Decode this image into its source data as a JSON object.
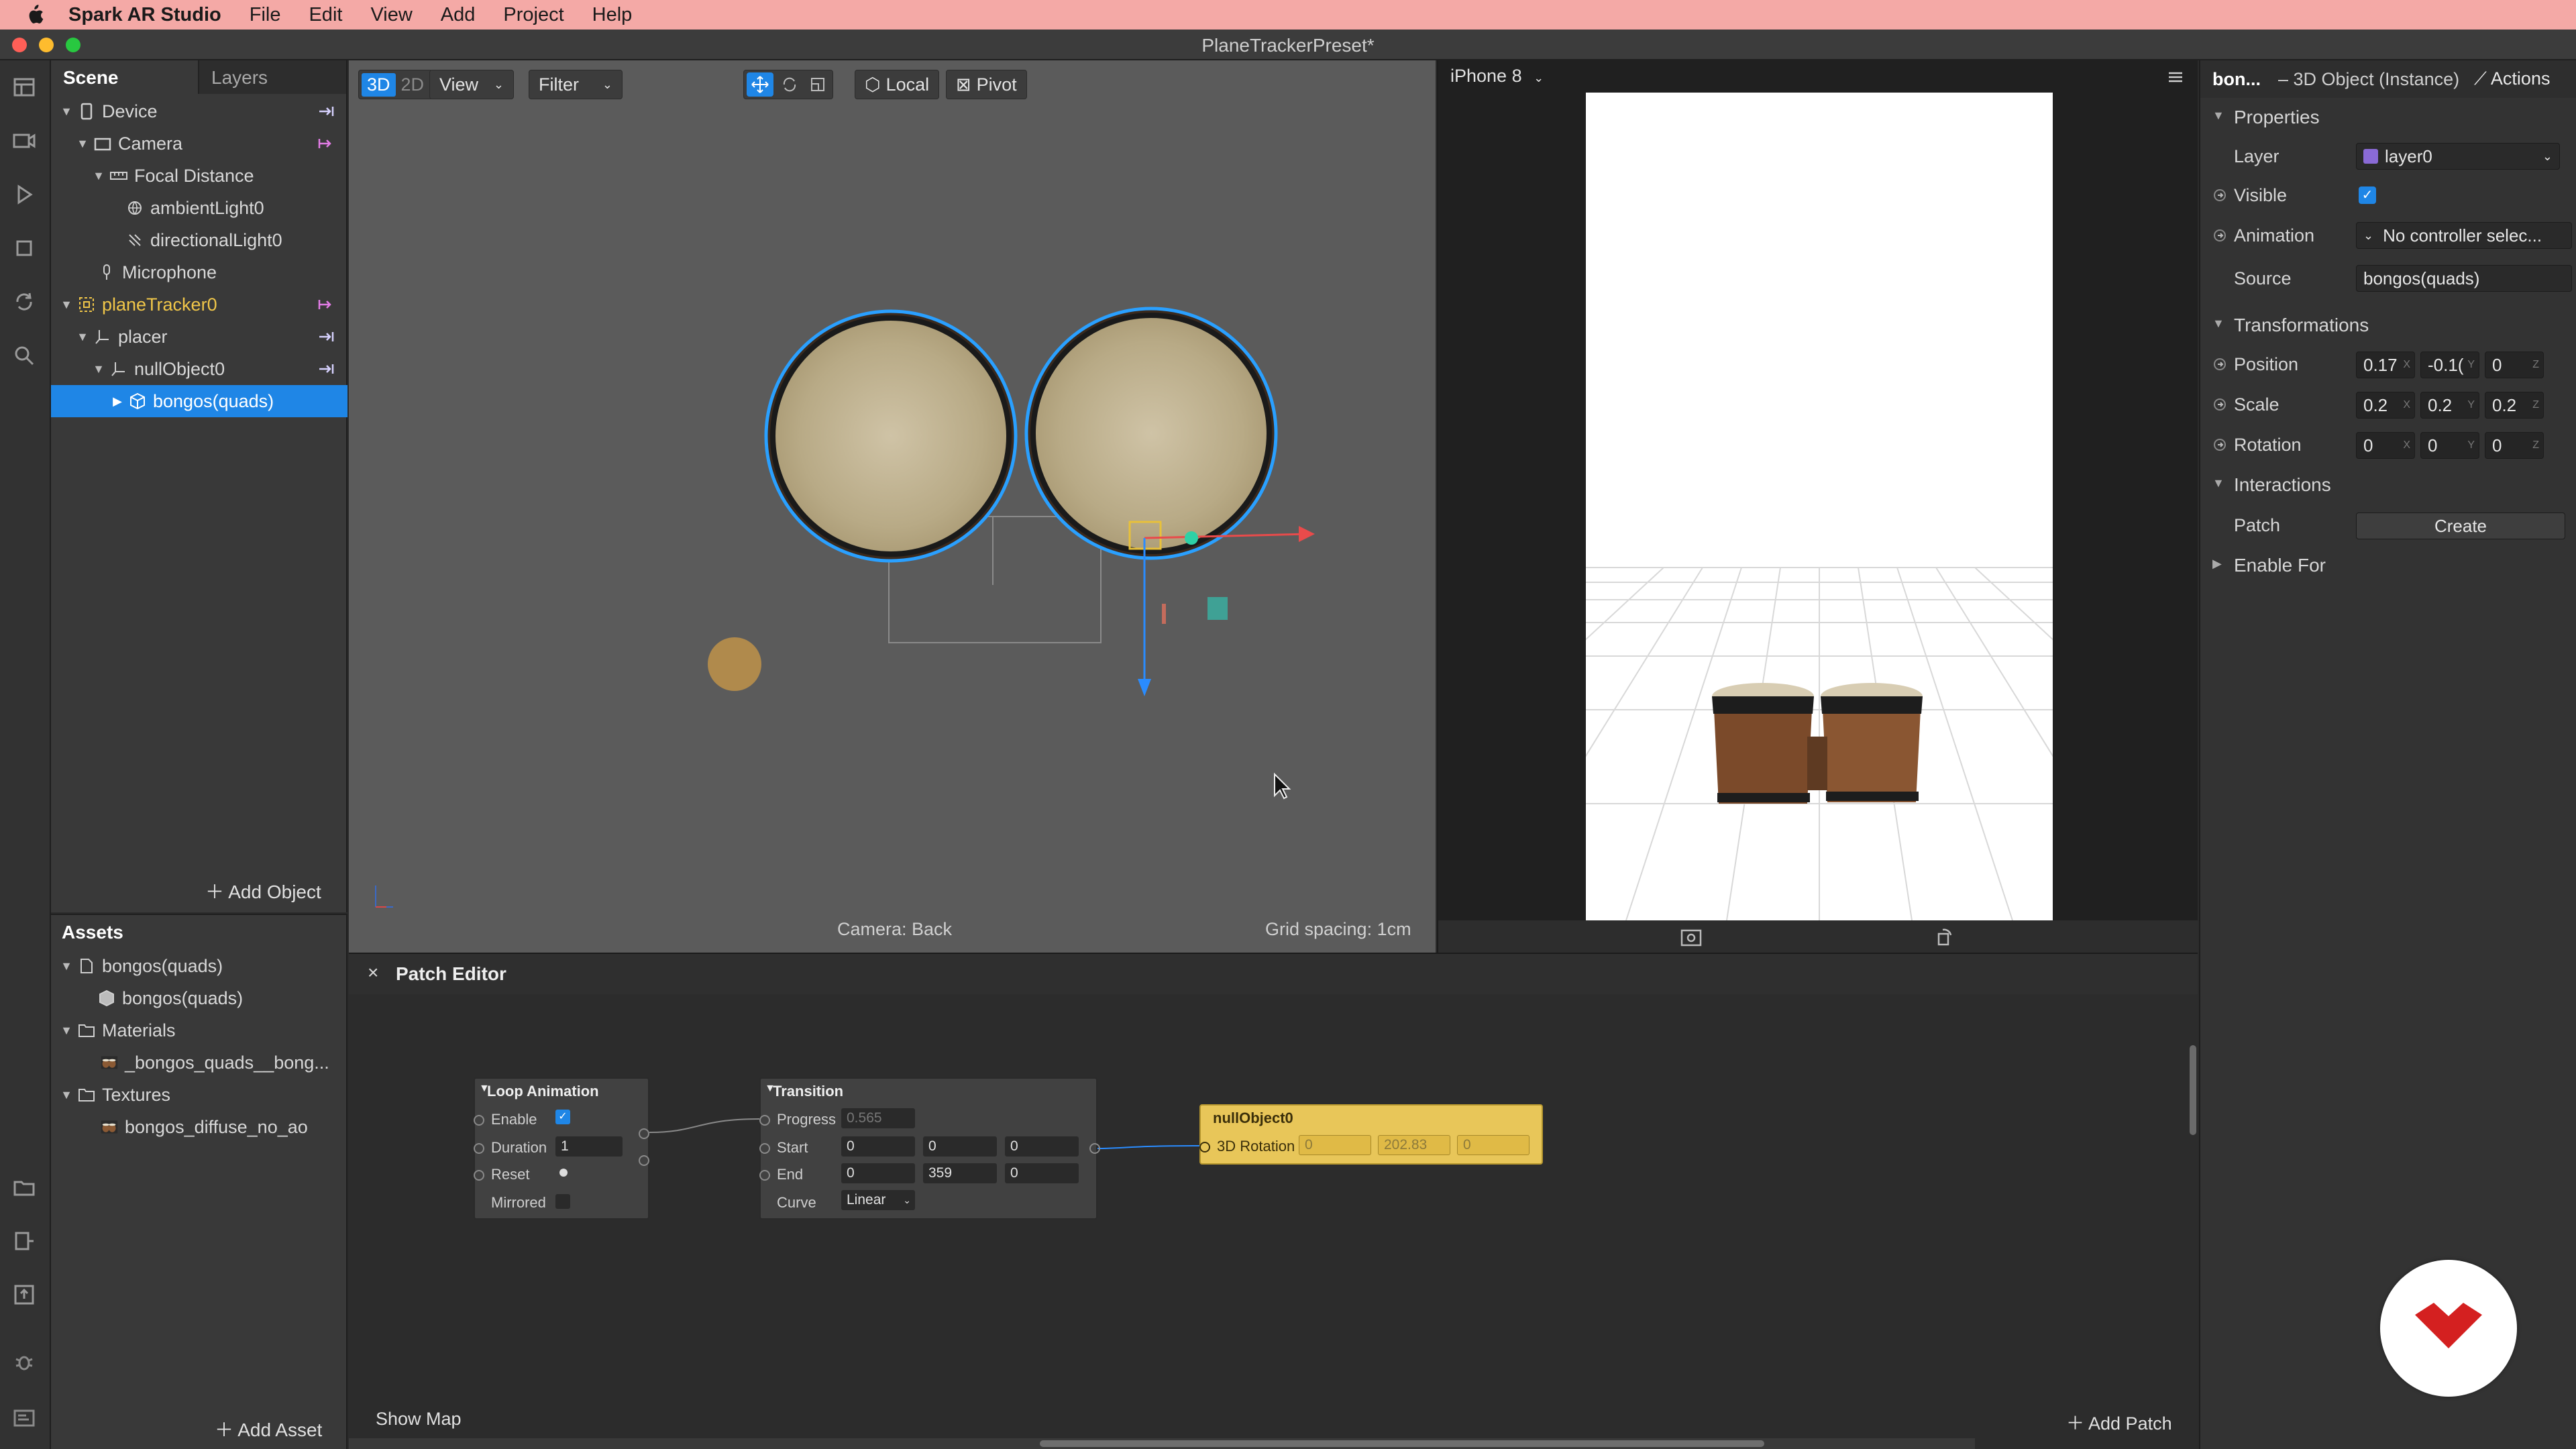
{
  "menubar": {
    "app_name": "Spark AR Studio",
    "items": [
      "File",
      "Edit",
      "View",
      "Add",
      "Project",
      "Help"
    ]
  },
  "window": {
    "title": "PlaneTrackerPreset*"
  },
  "scene_panel": {
    "tabs": [
      "Scene",
      "Layers"
    ],
    "tree": [
      {
        "label": "Device",
        "depth": 0
      },
      {
        "label": "Camera",
        "depth": 1
      },
      {
        "label": "Focal Distance",
        "depth": 2
      },
      {
        "label": "ambientLight0",
        "depth": 3
      },
      {
        "label": "directionalLight0",
        "depth": 3
      },
      {
        "label": "Microphone",
        "depth": 1
      },
      {
        "label": "planeTracker0",
        "depth": 0
      },
      {
        "label": "placer",
        "depth": 1
      },
      {
        "label": "nullObject0",
        "depth": 2
      },
      {
        "label": "bongos(quads)",
        "depth": 3,
        "selected": true
      }
    ],
    "add_object": "Add Object"
  },
  "assets_panel": {
    "title": "Assets",
    "tree": [
      {
        "label": "bongos(quads)",
        "depth": 0
      },
      {
        "label": "bongos(quads)",
        "depth": 1
      },
      {
        "label": "Materials",
        "depth": 0
      },
      {
        "label": "_bongos_quads__bong...",
        "depth": 1
      },
      {
        "label": "Textures",
        "depth": 0
      },
      {
        "label": "bongos_diffuse_no_ao",
        "depth": 1
      }
    ],
    "add_asset": "Add Asset"
  },
  "viewport": {
    "mode_3d": "3D",
    "mode_2d": "2D",
    "view_menu": "View",
    "filter_menu": "Filter",
    "local_button": "Local",
    "pivot_button": "Pivot",
    "camera_status": "Camera: Back",
    "grid_status": "Grid spacing: 1cm"
  },
  "simulator": {
    "device": "iPhone 8"
  },
  "inspector": {
    "object_name": "bon...",
    "object_type": "– 3D Object (Instance)",
    "actions": "Actions",
    "properties_header": "Properties",
    "layer_label": "Layer",
    "layer_value": "layer0",
    "visible_label": "Visible",
    "animation_label": "Animation",
    "animation_value": "No controller selec...",
    "source_label": "Source",
    "source_value": "bongos(quads)",
    "transformations_header": "Transformations",
    "position_label": "Position",
    "position": [
      "0.17",
      "-0.1(",
      "0"
    ],
    "scale_label": "Scale",
    "scale": [
      "0.2",
      "0.2",
      "0.2"
    ],
    "rotation_label": "Rotation",
    "rotation": [
      "0",
      "0",
      "0"
    ],
    "interactions_header": "Interactions",
    "patch_label": "Patch",
    "create_button": "Create",
    "enable_for": "Enable For",
    "axes": [
      "X",
      "Y",
      "Z"
    ]
  },
  "patch_editor": {
    "title": "Patch Editor",
    "show_map": "Show Map",
    "add_patch": "Add Patch",
    "loop_animation": {
      "title": "Loop Animation",
      "enable": "Enable",
      "duration": "Duration",
      "duration_value": "1",
      "reset": "Reset",
      "mirrored": "Mirrored"
    },
    "transition": {
      "title": "Transition",
      "progress": "Progress",
      "progress_value": "0.565",
      "start": "Start",
      "start_values": [
        "0",
        "0",
        "0"
      ],
      "end": "End",
      "end_values": [
        "0",
        "359",
        "0"
      ],
      "curve": "Curve",
      "curve_value": "Linear"
    },
    "null_object": {
      "title": "nullObject0",
      "port": "3D Rotation",
      "values": [
        "0",
        "202.83",
        "0"
      ]
    }
  }
}
